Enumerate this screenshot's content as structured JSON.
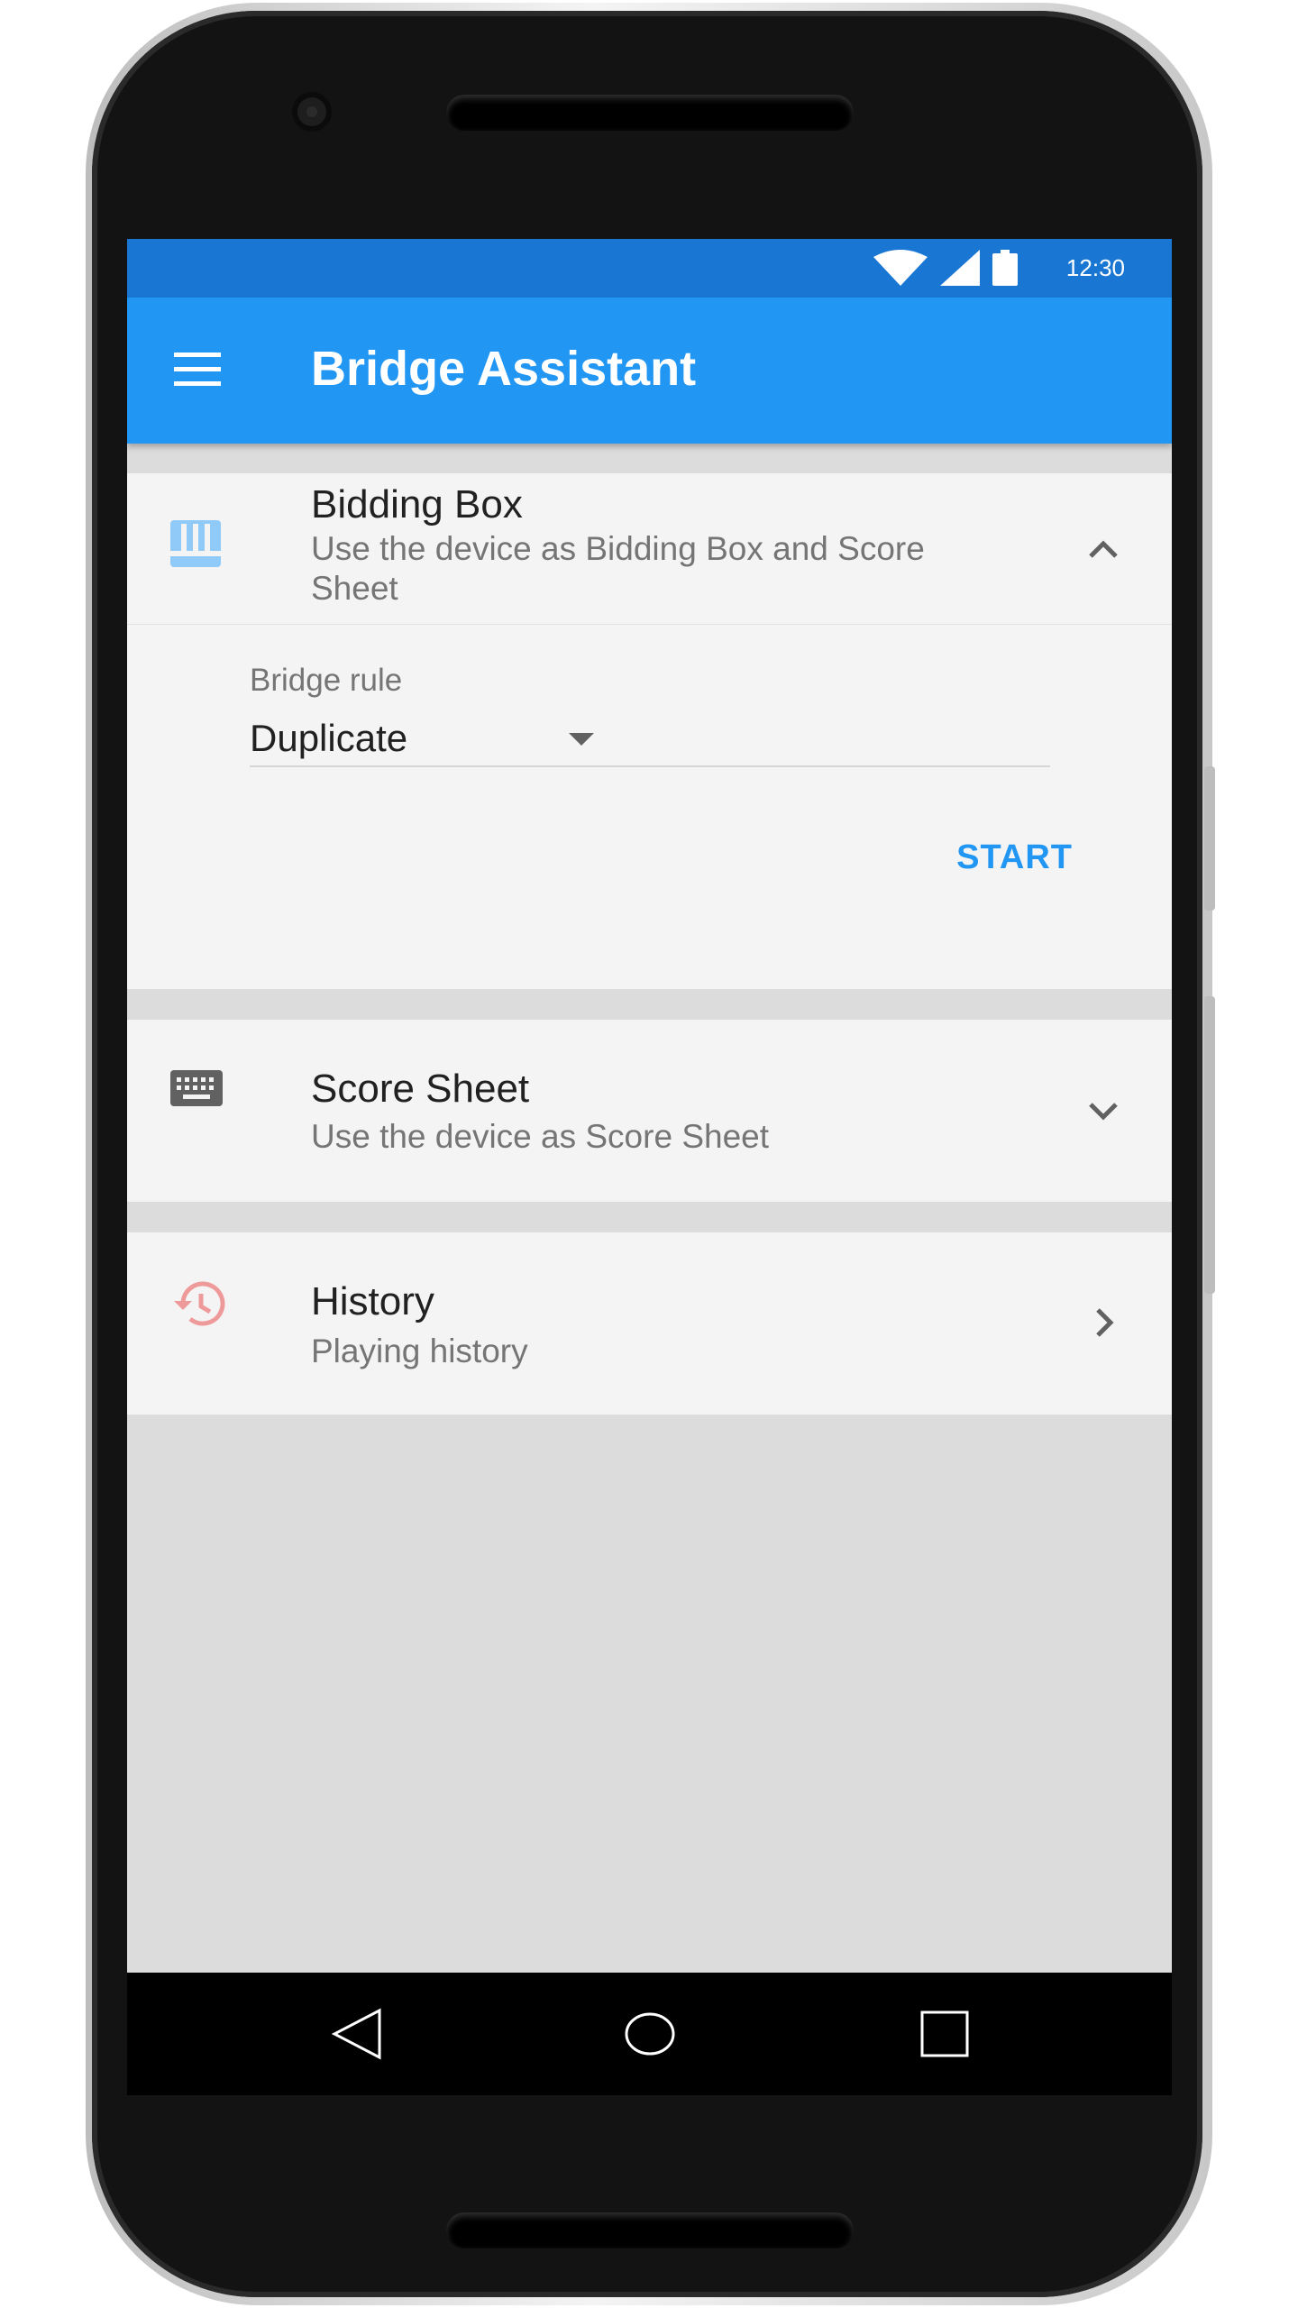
{
  "status_bar": {
    "time": "12:30"
  },
  "app_bar": {
    "title": "Bridge Assistant"
  },
  "colors": {
    "primary": "#2196f3",
    "primary_dark": "#1976d2",
    "accent_icon": "#90caf9",
    "history_icon": "#ef9a9a"
  },
  "cards": {
    "bidding_box": {
      "title": "Bidding Box",
      "subtitle": "Use the device as Bidding Box and Score Sheet",
      "icon": "bidding-box-icon",
      "expanded": true,
      "rule_label": "Bridge rule",
      "rule_value": "Duplicate",
      "start_label": "START"
    },
    "score_sheet": {
      "title": "Score Sheet",
      "subtitle": "Use the device as Score Sheet",
      "icon": "keyboard-icon",
      "expanded": false
    },
    "history": {
      "title": "History",
      "subtitle": "Playing history",
      "icon": "history-icon"
    }
  },
  "nav_bar": {
    "items": [
      "back-icon",
      "home-icon",
      "recents-icon"
    ]
  }
}
